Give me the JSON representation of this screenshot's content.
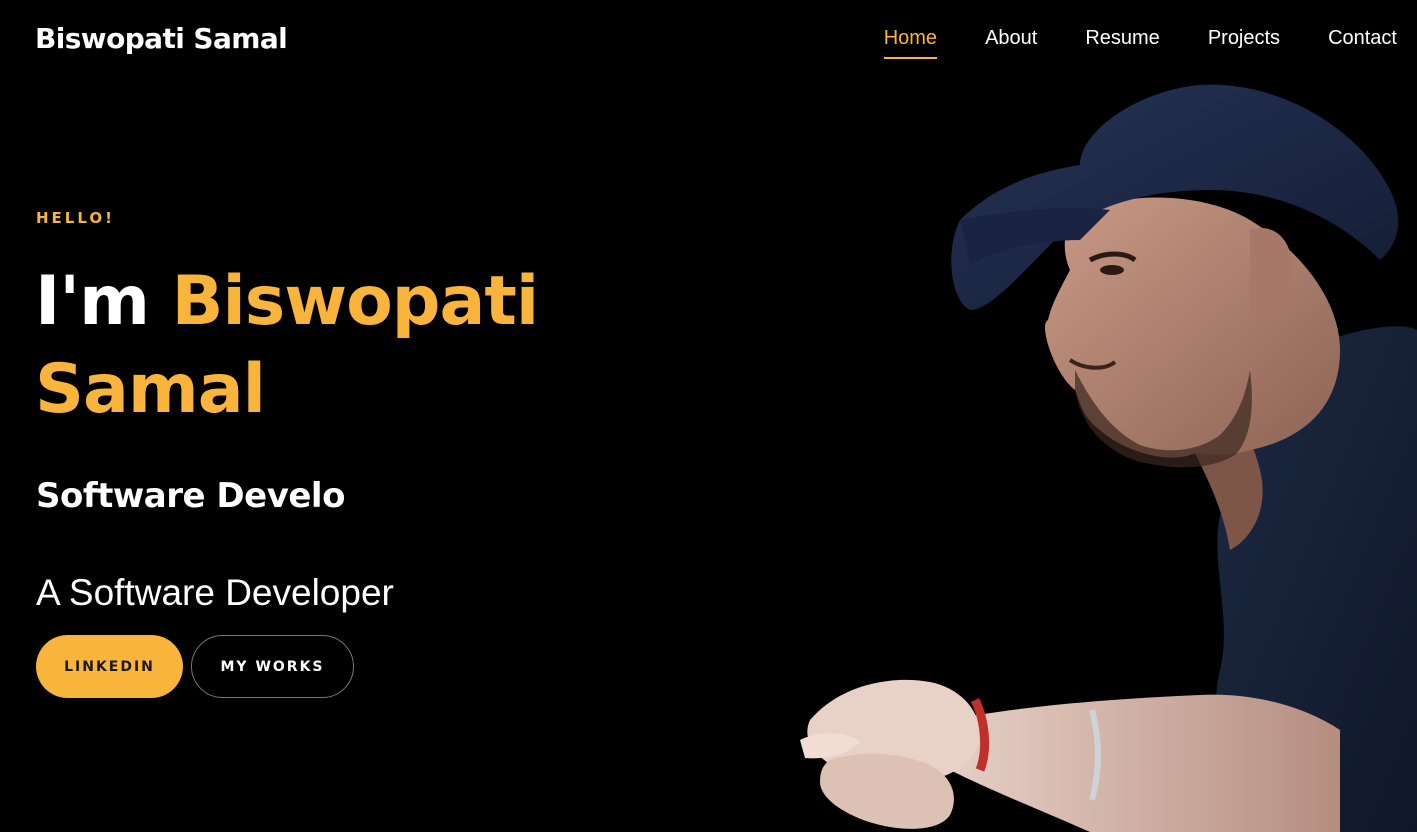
{
  "header": {
    "brand": "Biswopati Samal",
    "nav": [
      {
        "label": "Home",
        "active": true
      },
      {
        "label": "About",
        "active": false
      },
      {
        "label": "Resume",
        "active": false
      },
      {
        "label": "Projects",
        "active": false
      },
      {
        "label": "Contact",
        "active": false
      }
    ]
  },
  "hero": {
    "greeting": "HELLO!",
    "headline_prefix": "I'm ",
    "headline_name_line1": "Biswopati",
    "headline_name_line2": "Samal",
    "typed_text": "Software Develo",
    "subtitle": "A Software Developer",
    "buttons": {
      "primary": "LINKEDIN",
      "secondary": "MY WORKS"
    }
  },
  "theme": {
    "accent": "#f9b43b",
    "background": "#000000",
    "text": "#ffffff"
  },
  "icons": {
    "portrait": "profile-photo"
  }
}
